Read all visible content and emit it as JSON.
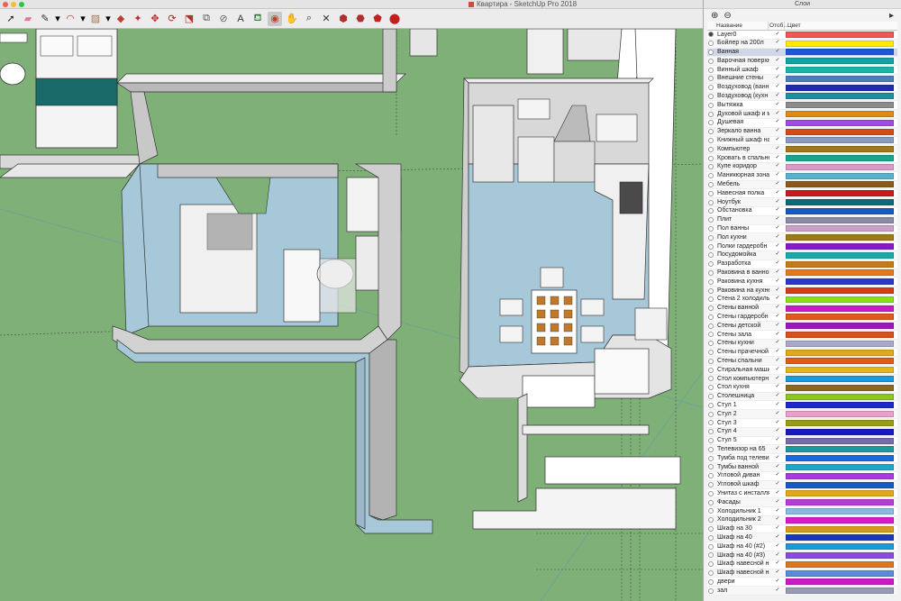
{
  "window": {
    "title": "Квартира - SketchUp Pro 2018",
    "traffic_colors": [
      "#f15f56",
      "#f8bc2e",
      "#27c83f"
    ]
  },
  "toolbar": {
    "tools": [
      {
        "icon": "select-arrow-icon",
        "glyph": "➚",
        "color": "#222"
      },
      {
        "icon": "eraser-icon",
        "glyph": "▰",
        "color": "#e07aa0"
      },
      {
        "icon": "pencil-line-icon",
        "glyph": "✎",
        "color": "#333",
        "dropdown": true
      },
      {
        "icon": "arc-icon",
        "glyph": "◠",
        "color": "#c03030",
        "dropdown": true
      },
      {
        "icon": "rectangle-shape-icon",
        "glyph": "▨",
        "color": "#a07a4a",
        "dropdown": true
      },
      {
        "icon": "push-pull-icon",
        "glyph": "◆",
        "color": "#c04030"
      },
      {
        "icon": "follow-me-icon",
        "glyph": "✦",
        "color": "#b83030"
      },
      {
        "icon": "move-icon",
        "glyph": "✥",
        "color": "#c02020"
      },
      {
        "icon": "rotate-icon",
        "glyph": "⟳",
        "color": "#c02020"
      },
      {
        "icon": "scale-icon",
        "glyph": "⬔",
        "color": "#b03030"
      },
      {
        "icon": "offset-icon",
        "glyph": "⧉",
        "color": "#555"
      },
      {
        "icon": "tape-measure-icon",
        "glyph": "⊘",
        "color": "#666"
      },
      {
        "icon": "text-label-icon",
        "glyph": "A",
        "color": "#333"
      },
      {
        "icon": "paint-bucket-icon",
        "glyph": "⛾",
        "color": "#3a7a3a"
      },
      {
        "icon": "orbit-icon",
        "glyph": "◉",
        "color": "#c04030",
        "active": true
      },
      {
        "icon": "pan-hand-icon",
        "glyph": "✋",
        "color": "#444"
      },
      {
        "icon": "zoom-icon",
        "glyph": "⌕",
        "color": "#333"
      },
      {
        "icon": "zoom-extents-icon",
        "glyph": "✕",
        "color": "#333"
      },
      {
        "icon": "warehouse-icon",
        "glyph": "⬢",
        "color": "#b03030"
      },
      {
        "icon": "extension-warehouse-icon",
        "glyph": "⬣",
        "color": "#b03030"
      },
      {
        "icon": "layout-send-icon",
        "glyph": "⬟",
        "color": "#c02020"
      },
      {
        "icon": "extension-manager-icon",
        "glyph": "⬤",
        "color": "#c02020"
      }
    ]
  },
  "layers": {
    "panel_title": "Слои",
    "add_icon": "add-layer-icon",
    "remove_icon": "remove-layer-icon",
    "details_icon": "details-arrow-icon",
    "header": {
      "name": "Название",
      "visible": "Отоб…",
      "color": "Цвет"
    },
    "items": [
      {
        "name": "Layer0",
        "color": "#f05656",
        "active": true
      },
      {
        "name": "Бойлер на 200л",
        "color": "#ffea00"
      },
      {
        "name": "Ванная",
        "color": "#1f56d8",
        "selected": true
      },
      {
        "name": "Варочная поверхн",
        "color": "#11a2a2"
      },
      {
        "name": "Винный шкаф",
        "color": "#1eb3a8"
      },
      {
        "name": "Внешние стены",
        "color": "#4f7bb6"
      },
      {
        "name": "Воздуховод (ванн",
        "color": "#1f2ea8"
      },
      {
        "name": "Воздуховод (кухн",
        "color": "#1f8fa0"
      },
      {
        "name": "Вытяжка",
        "color": "#8c8c8c"
      },
      {
        "name": "Духовой шкаф и м",
        "color": "#e08a16"
      },
      {
        "name": "Душевая",
        "color": "#a44ae0"
      },
      {
        "name": "Зеркало ванна",
        "color": "#d64a1a"
      },
      {
        "name": "Книжный шкаф на",
        "color": "#8a9ac0"
      },
      {
        "name": "Компьютер",
        "color": "#a0781a"
      },
      {
        "name": "Кровать в спальне",
        "color": "#1aa58a"
      },
      {
        "name": "Купе коридор",
        "color": "#d89ac8"
      },
      {
        "name": "Маникюрная зона",
        "color": "#5ab0c8"
      },
      {
        "name": "Мебель",
        "color": "#8a5a1a"
      },
      {
        "name": "Навесная полка",
        "color": "#c81a1a"
      },
      {
        "name": "Ноутбук",
        "color": "#0a6a7a"
      },
      {
        "name": "Обстановка",
        "color": "#1a58c8"
      },
      {
        "name": "Плит",
        "color": "#8a8aa8"
      },
      {
        "name": "Пол ванны",
        "color": "#c8a0c8"
      },
      {
        "name": "Пол кухни",
        "color": "#9a7a1a"
      },
      {
        "name": "Полки гардеробн",
        "color": "#8a1ac8"
      },
      {
        "name": "Посудомойка",
        "color": "#1aa8a8"
      },
      {
        "name": "Разработка",
        "color": "#c87a1a"
      },
      {
        "name": "Раковина в ванной",
        "color": "#e07a1a"
      },
      {
        "name": "Раковина кухня",
        "color": "#2a3ac8"
      },
      {
        "name": "Раковина на кухне",
        "color": "#d83a1a"
      },
      {
        "name": "Стена 2 холодиль",
        "color": "#8ae01a"
      },
      {
        "name": "Стены ванной",
        "color": "#c81ac8"
      },
      {
        "name": "Стены гардеробн",
        "color": "#e05a1a"
      },
      {
        "name": "Стены детской",
        "color": "#9a1ab8"
      },
      {
        "name": "Стены зала",
        "color": "#d8501a"
      },
      {
        "name": "Стены кухни",
        "color": "#a8a8c8"
      },
      {
        "name": "Стены прачечной",
        "color": "#e0a81a"
      },
      {
        "name": "Стены спальни",
        "color": "#e05a1a"
      },
      {
        "name": "Стиральная маши",
        "color": "#e0b81a"
      },
      {
        "name": "Стол компьютерн",
        "color": "#1a9ad8"
      },
      {
        "name": "Стол кухня",
        "color": "#8a6a1a"
      },
      {
        "name": "Столешница",
        "color": "#8ac81a"
      },
      {
        "name": "Стул 1",
        "color": "#1a2ac8"
      },
      {
        "name": "Стул 2",
        "color": "#e8a0c8"
      },
      {
        "name": "Стул 3",
        "color": "#9a9a1a"
      },
      {
        "name": "Стул 4",
        "color": "#1a1ab8"
      },
      {
        "name": "Стул 5",
        "color": "#7a6aa8"
      },
      {
        "name": "Телевизор на 65",
        "color": "#1a9a9a"
      },
      {
        "name": "Тумба под телеви",
        "color": "#1a6ad8"
      },
      {
        "name": "Тумбы ванной",
        "color": "#1aa8c8"
      },
      {
        "name": "Угловой диван",
        "color": "#a83ae0"
      },
      {
        "name": "Угловой шкаф",
        "color": "#1a58c8"
      },
      {
        "name": "Унитаз с инсталля",
        "color": "#e0a81a"
      },
      {
        "name": "Фасады",
        "color": "#b83ad8"
      },
      {
        "name": "Холодильник 1",
        "color": "#8ab8e0"
      },
      {
        "name": "Холодильник 2",
        "color": "#d81ac8"
      },
      {
        "name": "Шкаф на 30",
        "color": "#d89a1a"
      },
      {
        "name": "Шкаф на 40",
        "color": "#1a3ab8"
      },
      {
        "name": "Шкаф на 40 (#2)",
        "color": "#1a9ad8"
      },
      {
        "name": "Шкаф на 40 (#3)",
        "color": "#8a4ae0"
      },
      {
        "name": "Шкаф навесной н",
        "color": "#d87a1a"
      },
      {
        "name": "Шкаф навесной н",
        "color": "#5a8ad8"
      },
      {
        "name": "двери",
        "color": "#c81ac8"
      },
      {
        "name": "зал",
        "color": "#9a9ab8"
      }
    ]
  }
}
